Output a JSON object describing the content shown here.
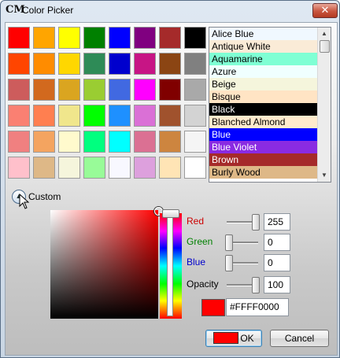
{
  "window": {
    "title": "Color Picker",
    "app_icon": "CM",
    "close_label": "✕"
  },
  "colors": {
    "accent": "#ff0000",
    "selected_list_bg": "#000000"
  },
  "swatches": [
    "#ff0000",
    "#ffa500",
    "#ffff00",
    "#008000",
    "#0000ff",
    "#800080",
    "#a52a2a",
    "#000000",
    "#ff4500",
    "#ff8c00",
    "#ffd700",
    "#2e8b57",
    "#0000cd",
    "#c71585",
    "#8b4513",
    "#808080",
    "#cd5c5c",
    "#d2691e",
    "#daa520",
    "#9acd32",
    "#4169e1",
    "#ff00ff",
    "#800000",
    "#a9a9a9",
    "#fa8072",
    "#ff7f50",
    "#f0e68c",
    "#00ff00",
    "#1e90ff",
    "#da70d6",
    "#a0522d",
    "#d3d3d3",
    "#f08080",
    "#f4a460",
    "#fffacd",
    "#00ff7f",
    "#00ffff",
    "#db7093",
    "#cd853f",
    "#f5f5f5",
    "#ffc0cb",
    "#deb887",
    "#f5f5dc",
    "#98fb98",
    "#f8f8ff",
    "#dda0dd",
    "#ffe4b5",
    "#ffffff"
  ],
  "color_list": {
    "items": [
      {
        "label": "Alice Blue",
        "bg": "#f0f8ff",
        "fg": "#000000"
      },
      {
        "label": "Antique White",
        "bg": "#faebd7",
        "fg": "#000000"
      },
      {
        "label": "Aquamarine",
        "bg": "#7fffd4",
        "fg": "#000000"
      },
      {
        "label": "Azure",
        "bg": "#f0ffff",
        "fg": "#000000"
      },
      {
        "label": "Beige",
        "bg": "#f5f5dc",
        "fg": "#000000"
      },
      {
        "label": "Bisque",
        "bg": "#ffe4c4",
        "fg": "#000000"
      },
      {
        "label": "Black",
        "bg": "#000000",
        "fg": "#ffffff"
      },
      {
        "label": "Blanched Almond",
        "bg": "#ffebcd",
        "fg": "#000000"
      },
      {
        "label": "Blue",
        "bg": "#0000ff",
        "fg": "#ffffff"
      },
      {
        "label": "Blue Violet",
        "bg": "#8a2be2",
        "fg": "#ffffff"
      },
      {
        "label": "Brown",
        "bg": "#a52a2a",
        "fg": "#ffffff"
      },
      {
        "label": "Burly Wood",
        "bg": "#deb887",
        "fg": "#000000"
      }
    ],
    "scroll_up_icon": "▲",
    "scroll_down_icon": "▼"
  },
  "custom": {
    "label": "Custom",
    "expander_icon": "▲"
  },
  "channels": [
    {
      "label": "Red",
      "color": "#cc0000",
      "value": "255",
      "level": 1.0
    },
    {
      "label": "Green",
      "color": "#008000",
      "value": "0",
      "level": 0.0
    },
    {
      "label": "Blue",
      "color": "#0000cc",
      "value": "0",
      "level": 0.0
    },
    {
      "label": "Opacity",
      "color": "#000000",
      "value": "100",
      "level": 1.0
    }
  ],
  "hex": {
    "value": "#FFFF0000"
  },
  "buttons": {
    "ok": "OK",
    "cancel": "Cancel"
  }
}
